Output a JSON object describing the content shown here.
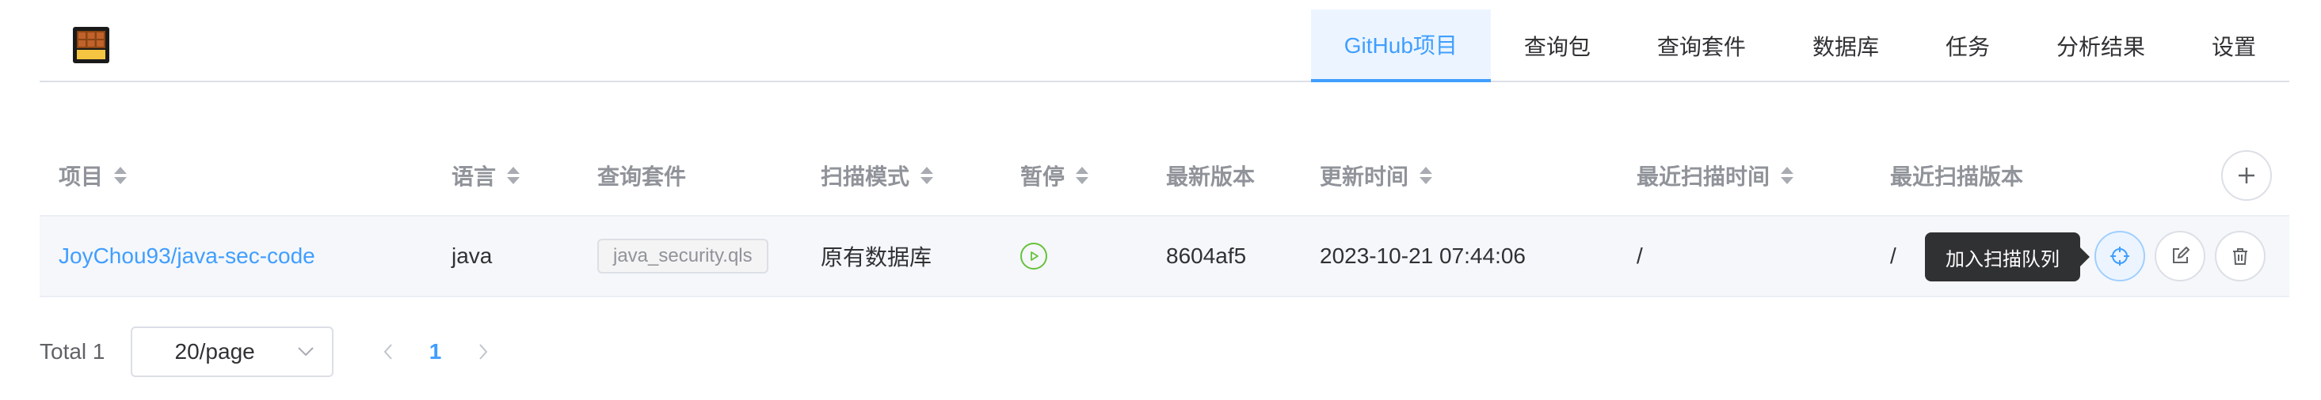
{
  "nav": {
    "items": [
      {
        "label": "GitHub项目",
        "active": true
      },
      {
        "label": "查询包",
        "active": false
      },
      {
        "label": "查询套件",
        "active": false
      },
      {
        "label": "数据库",
        "active": false
      },
      {
        "label": "任务",
        "active": false
      },
      {
        "label": "分析结果",
        "active": false
      },
      {
        "label": "设置",
        "active": false
      }
    ]
  },
  "table": {
    "columns": [
      {
        "label": "项目",
        "sortable": true
      },
      {
        "label": "语言",
        "sortable": true
      },
      {
        "label": "查询套件",
        "sortable": false
      },
      {
        "label": "扫描模式",
        "sortable": true
      },
      {
        "label": "暂停",
        "sortable": true
      },
      {
        "label": "最新版本",
        "sortable": false
      },
      {
        "label": "更新时间",
        "sortable": true
      },
      {
        "label": "最近扫描时间",
        "sortable": true
      },
      {
        "label": "最近扫描版本",
        "sortable": false
      }
    ],
    "rows": [
      {
        "project": "JoyChou93/java-sec-code",
        "language": "java",
        "suite": "java_security.qls",
        "scan_mode": "原有数据库",
        "latest_version": "8604af5",
        "updated_at": "2023-10-21 07:44:06",
        "last_scan_time": "/",
        "last_scan_version": "/"
      }
    ],
    "tooltip": "加入扫描队列"
  },
  "pagination": {
    "total": "Total 1",
    "page_size": "20/page",
    "current_page": "1"
  },
  "colors": {
    "primary": "#409eff",
    "success": "#67c23a",
    "header_text": "#909399",
    "row_bg": "#f5f7fa"
  }
}
